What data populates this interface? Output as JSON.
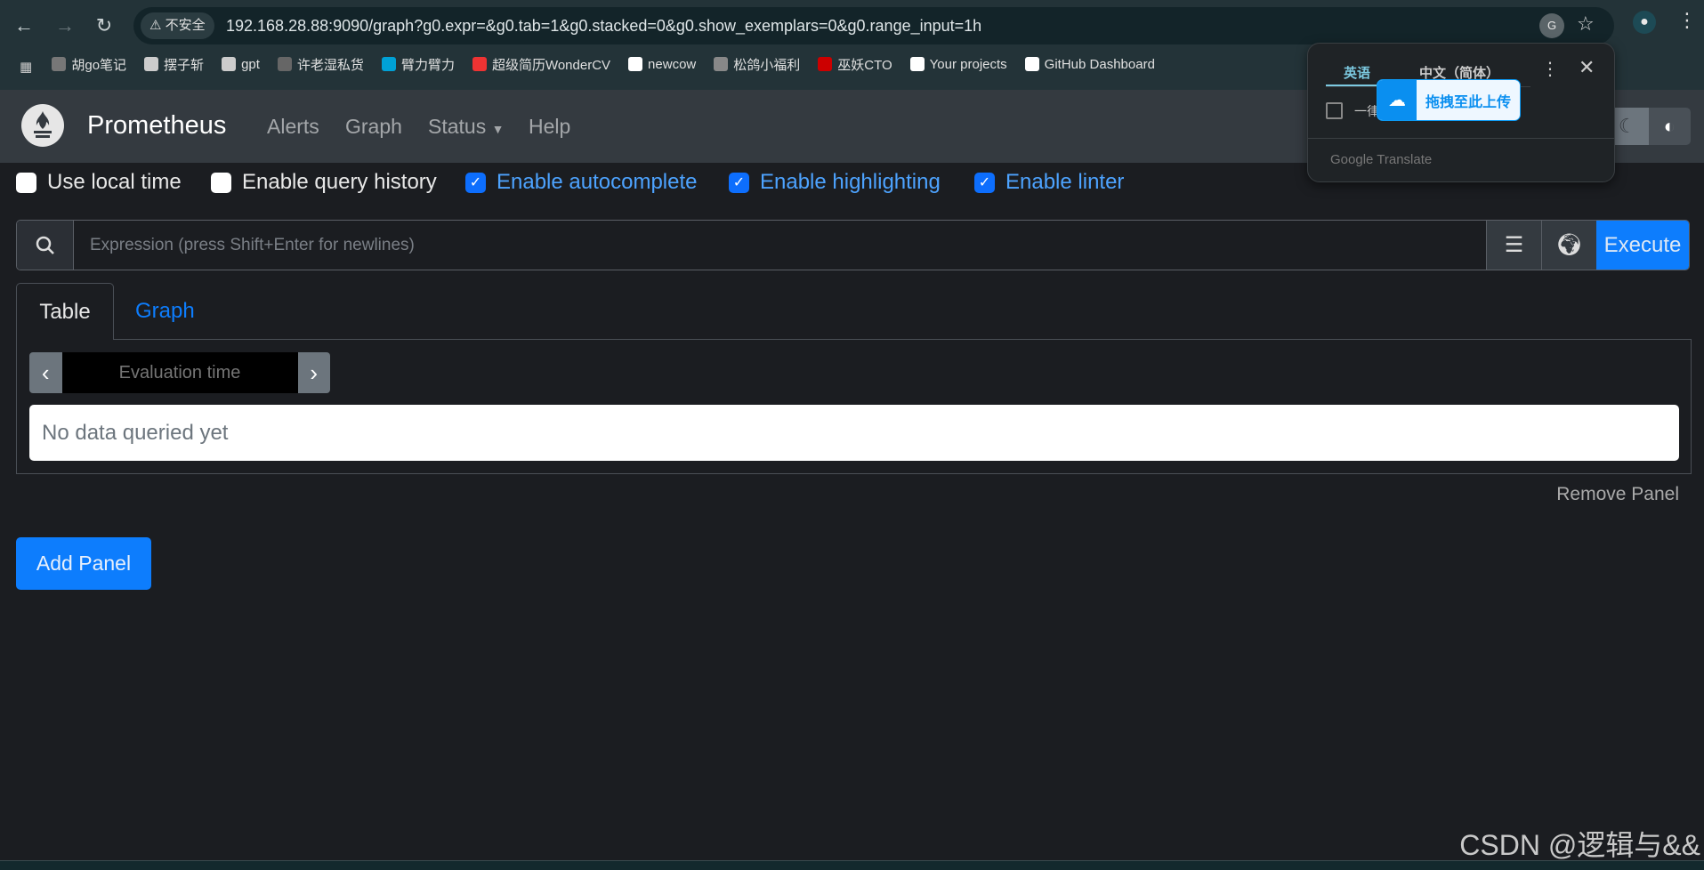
{
  "browser": {
    "url": "192.168.28.88:9090/graph?g0.expr=&g0.tab=1&g0.stacked=0&g0.show_exemplars=0&g0.range_input=1h",
    "security_label": "不安全",
    "bookmarks": [
      {
        "label": "胡go笔记",
        "color": "#777"
      },
      {
        "label": "摆子斩",
        "color": "#ccc"
      },
      {
        "label": "gpt",
        "color": "#ccc"
      },
      {
        "label": "许老湿私货",
        "color": "#666"
      },
      {
        "label": "臂力臂力",
        "color": "#00a1d6"
      },
      {
        "label": "超级简历WonderCV",
        "color": "#e33"
      },
      {
        "label": "newcow",
        "color": "#fff"
      },
      {
        "label": "松鸽小福利",
        "color": "#888"
      },
      {
        "label": "巫妖CTO",
        "color": "#c00"
      },
      {
        "label": "Your projects",
        "color": "#fff"
      },
      {
        "label": "GitHub Dashboard",
        "color": "#fff"
      }
    ]
  },
  "navbar": {
    "brand": "Prometheus",
    "links": [
      "Alerts",
      "Graph",
      "Status",
      "Help"
    ]
  },
  "options": [
    {
      "label": "Use local time",
      "checked": false
    },
    {
      "label": "Enable query history",
      "checked": false
    },
    {
      "label": "Enable autocomplete",
      "checked": true
    },
    {
      "label": "Enable highlighting",
      "checked": true
    },
    {
      "label": "Enable linter",
      "checked": true
    }
  ],
  "query": {
    "placeholder": "Expression (press Shift+Enter for newlines)",
    "execute": "Execute"
  },
  "tabs": [
    "Table",
    "Graph"
  ],
  "panel": {
    "eval_placeholder": "Evaluation time",
    "empty": "No data queried yet",
    "remove": "Remove Panel"
  },
  "add_panel": "Add Panel",
  "translate": {
    "lang_from": "英语",
    "lang_to": "中文（简体）",
    "always": "一律",
    "upload": "拖拽至此上传",
    "footer": "Google Translate"
  },
  "watermark": "CSDN @逻辑与&&",
  "colors": {
    "accent": "#0d7dfd",
    "navbar": "#343a40",
    "background": "#1b1d21"
  }
}
